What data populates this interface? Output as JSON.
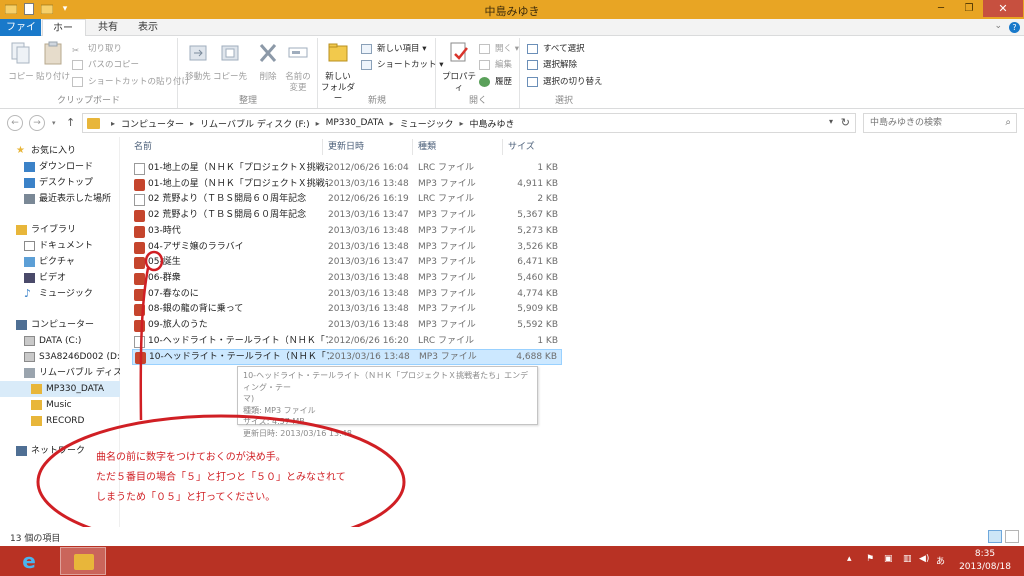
{
  "window": {
    "title": "中島みゆき",
    "accent": "#e8a524",
    "controls": {
      "min": "─",
      "max": "❐",
      "close": "✕"
    }
  },
  "ribbon_tabs": [
    "ファイル",
    "ホーム",
    "共有",
    "表示"
  ],
  "ribbon": {
    "clipboard": {
      "copy": "コピー",
      "paste": "貼り付け",
      "cut": "切り取り",
      "copy_path": "パスのコピー",
      "paste_shortcut": "ショートカットの貼り付け",
      "label": "クリップボード"
    },
    "organize": {
      "move_to": "移動先",
      "copy_to": "コピー先",
      "delete": "削除",
      "rename_1": "名前の",
      "rename_2": "変更",
      "label": "整理"
    },
    "new": {
      "new_folder_1": "新しい",
      "new_folder_2": "フォルダー",
      "new_item": "新しい項目",
      "shortcut": "ショートカット",
      "label": "新規"
    },
    "open": {
      "properties": "プロパティ",
      "open": "開く",
      "edit": "編集",
      "history": "履歴",
      "label": "開く"
    },
    "select": {
      "select_all": "すべて選択",
      "select_none": "選択解除",
      "invert": "選択の切り替え",
      "label": "選択"
    }
  },
  "address": {
    "crumbs": [
      "コンピューター",
      "リムーバブル ディスク (F:)",
      "MP330_DATA",
      "ミュージック",
      "中島みゆき"
    ],
    "search_placeholder": "中島みゆきの検索"
  },
  "nav_pane": {
    "favorites": "お気に入り",
    "downloads": "ダウンロード",
    "desktop": "デスクトップ",
    "recent": "最近表示した場所",
    "libraries": "ライブラリ",
    "documents": "ドキュメント",
    "pictures": "ピクチャ",
    "videos": "ビデオ",
    "music": "ミュージック",
    "computer": "コンピューター",
    "data_c": "DATA (C:)",
    "s3a": "S3A8246D002 (D:)",
    "removable": "リムーバブル ディスク (F",
    "mp330": "MP330_DATA",
    "music_folder": "Music",
    "record": "RECORD",
    "network": "ネットワーク"
  },
  "columns": {
    "name": "名前",
    "date": "更新日時",
    "type": "種類",
    "size": "サイズ"
  },
  "files": [
    {
      "name": "01-地上の星（ＮＨＫ「プロジェクトＸ挑戦者たち」",
      "date": "2012/06/26 16:04",
      "type": "LRC ファイル",
      "size": "1 KB",
      "kind": "lrc"
    },
    {
      "name": "01-地上の星（ＮＨＫ「プロジェクトＸ挑戦者たち」",
      "date": "2013/03/16 13:48",
      "type": "MP3 ファイル",
      "size": "4,911 KB",
      "kind": "mp3"
    },
    {
      "name": "02 荒野より（ＴＢＳ開局６０周年記念",
      "date": "2012/06/26 16:19",
      "type": "LRC ファイル",
      "size": "2 KB",
      "kind": "lrc"
    },
    {
      "name": "02 荒野より（ＴＢＳ開局６０周年記念",
      "date": "2013/03/16 13:47",
      "type": "MP3 ファイル",
      "size": "5,367 KB",
      "kind": "mp3"
    },
    {
      "name": "03-時代",
      "date": "2013/03/16 13:48",
      "type": "MP3 ファイル",
      "size": "5,273 KB",
      "kind": "mp3"
    },
    {
      "name": "04-アザミ嬢のララバイ",
      "date": "2013/03/16 13:48",
      "type": "MP3 ファイル",
      "size": "3,526 KB",
      "kind": "mp3"
    },
    {
      "name": "05-誕生",
      "date": "2013/03/16 13:47",
      "type": "MP3 ファイル",
      "size": "6,471 KB",
      "kind": "mp3"
    },
    {
      "name": "06-群衆",
      "date": "2013/03/16 13:48",
      "type": "MP3 ファイル",
      "size": "5,460 KB",
      "kind": "mp3"
    },
    {
      "name": "07-春なのに",
      "date": "2013/03/16 13:48",
      "type": "MP3 ファイル",
      "size": "4,774 KB",
      "kind": "mp3"
    },
    {
      "name": "08-銀の龍の背に乗って",
      "date": "2013/03/16 13:48",
      "type": "MP3 ファイル",
      "size": "5,909 KB",
      "kind": "mp3"
    },
    {
      "name": "09-旅人のうた",
      "date": "2013/03/16 13:48",
      "type": "MP3 ファイル",
      "size": "5,592 KB",
      "kind": "mp3"
    },
    {
      "name": "10-ヘッドライト・テールライト（ＮＨＫ「プロジェクトＸ",
      "date": "2012/06/26 16:20",
      "type": "LRC ファイル",
      "size": "1 KB",
      "kind": "lrc"
    },
    {
      "name": "10-ヘッドライト・テールライト（ＮＨＫ「プロジェクトＸ",
      "date": "2013/03/16 13:48",
      "type": "MP3 ファイル",
      "size": "4,688 KB",
      "kind": "mp3"
    }
  ],
  "tooltip": {
    "line1": "10-ヘッドライト・テールライト（ＮＨＫ「プロジェクトＸ挑戦者たち」エンディング・テー",
    "line2": "マ)",
    "line3": "種類: MP3 ファイル",
    "line4": "サイズ: 4.57 MB",
    "line5": "更新日時: 2013/03/16 13:48"
  },
  "annotation": {
    "line1": "曲名の前に数字をつけておくのが決め手。",
    "line2": "ただ５番目の場合「５」と打つと「５０」とみなされて",
    "line3": "しまうため「０５」と打ってください。",
    "color": "#d01f24"
  },
  "status": {
    "count": "13 個の項目"
  },
  "taskbar": {
    "time": "8:35",
    "date": "2013/08/18",
    "ime": "あ"
  }
}
